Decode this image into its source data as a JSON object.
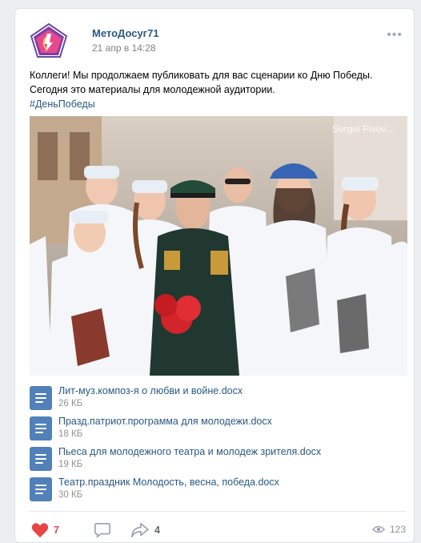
{
  "post": {
    "author": "МетоДосуг71",
    "date": "21 апр в 14:28",
    "more_label": "•••",
    "text": "Коллеги! Мы продолжаем публиковать для вас сценарии ко Дню Победы. Сегодня это материалы для молодежной аудитории.",
    "hashtag": "#ДеньПобеды"
  },
  "photo": {
    "watermark": "Sergei Pivov..."
  },
  "documents": [
    {
      "title": "Лит-муз.композ-я о любви и войне.docx",
      "size": "26 КБ"
    },
    {
      "title": "Празд.патриот.программа для молодежи.docx",
      "size": "18 КБ"
    },
    {
      "title": "Пьеса для молодежного театра и молодеж зрителя.docx",
      "size": "19 КБ"
    },
    {
      "title": "Театр.праздник Молодость, весна, победа.docx",
      "size": "30 КБ"
    }
  ],
  "footer": {
    "likes": "7",
    "shares": "4",
    "views": "123"
  },
  "colors": {
    "link": "#2a5885",
    "like": "#e64646",
    "doc_icon": "#5181b8",
    "muted": "#939393"
  },
  "icons": {
    "like": "heart-icon",
    "comment": "comment-icon",
    "share": "share-arrow-icon",
    "views": "eye-icon",
    "doc": "document-icon"
  }
}
